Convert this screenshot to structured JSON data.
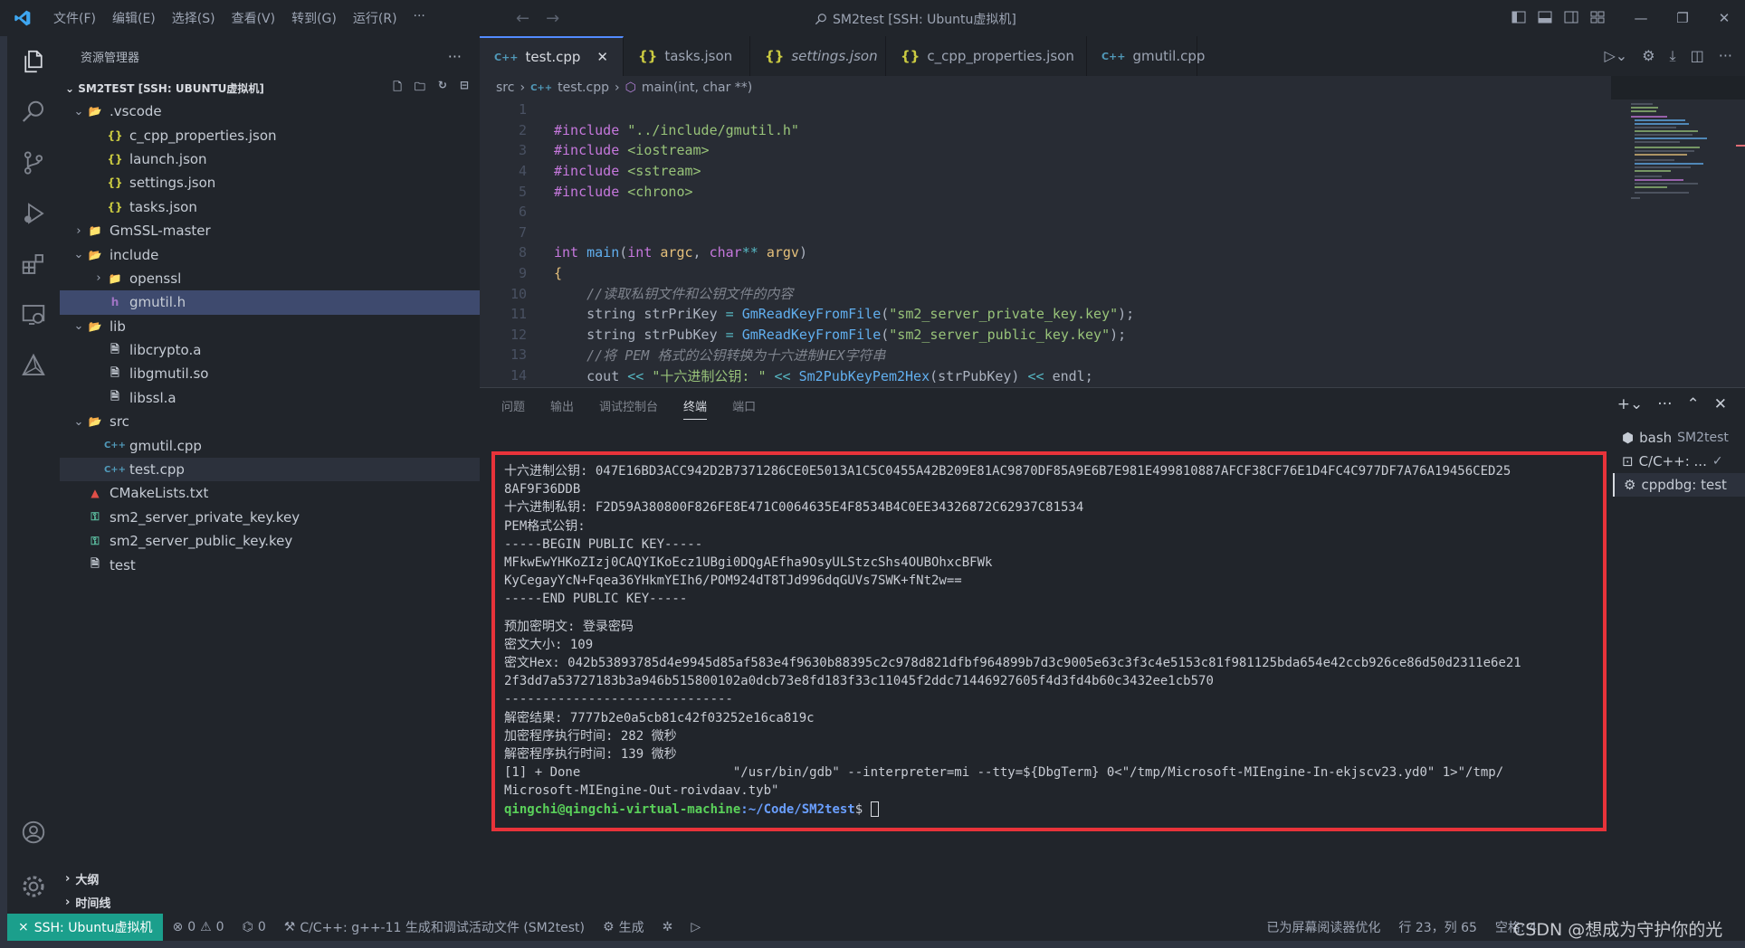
{
  "titlebar": {
    "menu": [
      "文件(F)",
      "编辑(E)",
      "选择(S)",
      "查看(V)",
      "转到(G)",
      "运行(R)",
      "···"
    ],
    "title": "SM2test [SSH: Ubuntu虚拟机]"
  },
  "sidebar": {
    "header": "资源管理器",
    "section": "SM2TEST [SSH: UBUNTU虚拟机]",
    "tree": [
      {
        "label": ".vscode",
        "depth": 1,
        "kind": "folder-open",
        "icon": "vscode-folder-icon"
      },
      {
        "label": "c_cpp_properties.json",
        "depth": 2,
        "kind": "json"
      },
      {
        "label": "launch.json",
        "depth": 2,
        "kind": "json"
      },
      {
        "label": "settings.json",
        "depth": 2,
        "kind": "json"
      },
      {
        "label": "tasks.json",
        "depth": 2,
        "kind": "json"
      },
      {
        "label": "GmSSL-master",
        "depth": 1,
        "kind": "folder-closed"
      },
      {
        "label": "include",
        "depth": 1,
        "kind": "folder-open"
      },
      {
        "label": "openssl",
        "depth": 2,
        "kind": "folder-closed"
      },
      {
        "label": "gmutil.h",
        "depth": 2,
        "kind": "h",
        "selected": true
      },
      {
        "label": "lib",
        "depth": 1,
        "kind": "folder-open"
      },
      {
        "label": "libcrypto.a",
        "depth": 2,
        "kind": "file"
      },
      {
        "label": "libgmutil.so",
        "depth": 2,
        "kind": "file"
      },
      {
        "label": "libssl.a",
        "depth": 2,
        "kind": "file"
      },
      {
        "label": "src",
        "depth": 1,
        "kind": "folder-open"
      },
      {
        "label": "gmutil.cpp",
        "depth": 2,
        "kind": "cpp"
      },
      {
        "label": "test.cpp",
        "depth": 2,
        "kind": "cpp",
        "active": true
      },
      {
        "label": "CMakeLists.txt",
        "depth": 1,
        "kind": "cmake"
      },
      {
        "label": "sm2_server_private_key.key",
        "depth": 1,
        "kind": "key"
      },
      {
        "label": "sm2_server_public_key.key",
        "depth": 1,
        "kind": "key"
      },
      {
        "label": "test",
        "depth": 1,
        "kind": "file"
      }
    ],
    "outline": "大纲",
    "timeline": "时间线"
  },
  "tabs": [
    {
      "label": "test.cpp",
      "icon": "C++",
      "active": true
    },
    {
      "label": "tasks.json",
      "icon": "{}"
    },
    {
      "label": "settings.json",
      "icon": "{}",
      "italic": true
    },
    {
      "label": "c_cpp_properties.json",
      "icon": "{}"
    },
    {
      "label": "gmutil.cpp",
      "icon": "C++"
    }
  ],
  "breadcrumb": [
    "src",
    "test.cpp",
    "main(int, char **)"
  ],
  "code": [
    {
      "n": "1",
      "html": ""
    },
    {
      "n": "2",
      "html": "<span class='kw'>#include</span> <span class='str'>\"../include/gmutil.h\"</span>"
    },
    {
      "n": "3",
      "html": "<span class='kw'>#include</span> <span class='str'>&lt;iostream&gt;</span>"
    },
    {
      "n": "4",
      "html": "<span class='kw'>#include</span> <span class='str'>&lt;sstream&gt;</span>"
    },
    {
      "n": "5",
      "html": "<span class='kw'>#include</span> <span class='str'>&lt;chrono&gt;</span>"
    },
    {
      "n": "6",
      "html": ""
    },
    {
      "n": "7",
      "html": ""
    },
    {
      "n": "8",
      "html": "<span class='kw'>int</span> <span class='fn'>main</span><span class='plain'>(</span><span class='kw'>int</span> <span class='ty'>argc</span><span class='plain'>, </span><span class='kw'>char</span><span class='op'>**</span> <span class='ty'>argv</span><span class='plain'>)</span>"
    },
    {
      "n": "9",
      "html": "<span class='ty'>{</span>"
    },
    {
      "n": "10",
      "html": "    <span class='cm'>//读取私钥文件和公钥文件的内容</span>"
    },
    {
      "n": "11",
      "html": "    <span class='plain'>string strPriKey </span><span class='op'>=</span> <span class='fn'>GmReadKeyFromFile</span><span class='plain'>(</span><span class='str'>\"sm2_server_private_key.key\"</span><span class='plain'>);</span>"
    },
    {
      "n": "12",
      "html": "    <span class='plain'>string strPubKey </span><span class='op'>=</span> <span class='fn'>GmReadKeyFromFile</span><span class='plain'>(</span><span class='str'>\"sm2_server_public_key.key\"</span><span class='plain'>);</span>"
    },
    {
      "n": "13",
      "html": "    <span class='cm'>//将 PEM 格式的公钥转换为十六进制HEX字符串</span>"
    },
    {
      "n": "14",
      "html": "    <span class='plain'>cout </span><span class='op'>&lt;&lt;</span> <span class='str'>\"十六进制公钥: \"</span> <span class='op'>&lt;&lt;</span> <span class='fn'>Sm2PubKeyPem2Hex</span><span class='plain'>(strPubKey) </span><span class='op'>&lt;&lt;</span> <span class='plain'>endl;</span>"
    }
  ],
  "panel": {
    "tabs": [
      "问题",
      "输出",
      "调试控制台",
      "终端",
      "端口"
    ],
    "active_tab": "终端",
    "terminals": [
      {
        "name": "bash",
        "sub": "SM2test"
      },
      {
        "name": "C/C++: ...",
        "sub": "✓"
      },
      {
        "name": "cppdbg: test",
        "sub": "",
        "active": true
      }
    ],
    "terminal_lines": [
      "十六进制公钥: 047E16BD3ACC942D2B7371286CE0E5013A1C5C0455A42B209E81AC9870DF85A9E6B7E981E499810887AFCF38CF76E1D4FC4C977DF7A76A19456CED25",
      "8AF9F36DDB",
      "十六进制私钥: F2D59A380800F826FE8E471C0064635E4F8534B4C0EE34326872C62937C81534",
      "PEM格式公钥:",
      "-----BEGIN PUBLIC KEY-----",
      "MFkwEwYHKoZIzj0CAQYIKoEcz1UBgi0DQgAEfha9OsyULStzcShs4OUBOhxcBFWk",
      "KyCegayYcN+Fqea36YHkmYEIh6/POM924dT8TJd996dqGUVs7SWK+fNt2w==",
      "-----END PUBLIC KEY-----",
      "",
      "预加密明文: 登录密码",
      "密文大小: 109",
      "密文Hex: 042b53893785d4e9945d85af583e4f9630b88395c2c978d821dfbf964899b7d3c9005e63c3f3c4e5153c81f981125bda654e42ccb926ce86d50d2311e6e21",
      "2f3dd7a53727183b3a946b515800102a0dcb73e8fd183f33c11045f2ddc71446927605f4d3fd4b60c3432ee1cb570",
      "------------------------------",
      "解密结果: 7777b2e0a5cb81c42f03252e16ca819c",
      "加密程序执行时间: 282 微秒",
      "解密程序执行时间: 139 微秒",
      "[1] + Done                    \"/usr/bin/gdb\" --interpreter=mi --tty=${DbgTerm} 0<\"/tmp/Microsoft-MIEngine-In-ekjscv23.yd0\" 1>\"/tmp/",
      "Microsoft-MIEngine-Out-roivdaav.tyb\""
    ],
    "prompt_user": "qingchi@qingchi-virtual-machine",
    "prompt_path": ":~/Code/SM2test",
    "prompt_end": "$ "
  },
  "statusbar": {
    "remote": "SSH: Ubuntu虚拟机",
    "errors": "0",
    "warnings": "0",
    "ports": "0",
    "task": "C/C++: g++-11 生成和调试活动文件 (SM2test)",
    "build": "生成",
    "screenreader": "已为屏幕阅读器优化",
    "position": "行 23，列 65",
    "spaces": "空格: 4"
  },
  "watermark": "CSDN @想成为守护你的光"
}
